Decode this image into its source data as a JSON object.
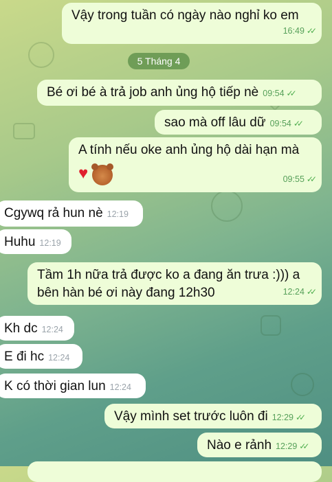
{
  "date_divider": "5 Tháng 4",
  "messages": [
    {
      "text": "Vậy trong tuần có ngày nào nghỉ ko em",
      "time": "16:49"
    },
    {
      "text": "Bé ơi bé à trả job anh ủng hộ tiếp nè",
      "time": "09:54"
    },
    {
      "text": "sao mà off lâu dữ",
      "time": "09:54"
    },
    {
      "text": "A tính nếu oke anh ủng hộ dài hạn mà",
      "time": "09:55"
    },
    {
      "text": "Cgywq rả hun nè",
      "time": "12:19"
    },
    {
      "text": "Huhu",
      "time": "12:19"
    },
    {
      "text_line1": "Tầm 1h nữa trả được ko a đang ăn trưa :))) a",
      "text_line2": "bên hàn bé ơi này đang 12h30",
      "time": "12:24"
    },
    {
      "text": "Kh dc",
      "time": "12:24"
    },
    {
      "text": "E đi hc",
      "time": "12:24"
    },
    {
      "text": "K có thời gian lun",
      "time": "12:24"
    },
    {
      "text": "Vậy mình set trước luôn đi",
      "time": "12:29"
    },
    {
      "text": "Nào e rảnh",
      "time": "12:29"
    }
  ],
  "icons": {
    "heart": "heart-emoji-icon",
    "bear": "bear-sticker-icon",
    "read": "double-check-icon"
  },
  "colors": {
    "outgoing": "#eefdd8",
    "incoming": "#ffffff",
    "time_green": "#57a05a"
  }
}
